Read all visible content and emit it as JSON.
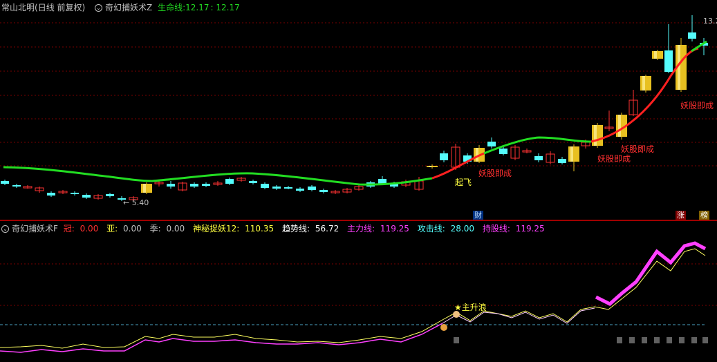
{
  "top": {
    "stock_name": "常山北明",
    "period": "(日线 前复权)",
    "indicator": "奇幻捕妖术Z",
    "line_label": "生命线:",
    "line_value1": "12.17",
    "line_value2": ": 12.17",
    "price_high": "13.2",
    "price_low": "5.40",
    "tags": [
      "起飞",
      "妖股即成",
      "妖股即成",
      "妖股即成",
      "妖股即成"
    ],
    "badges": [
      "财",
      "涨",
      "榜"
    ]
  },
  "bottom": {
    "indicator": "奇幻捕妖术F",
    "fields": [
      {
        "label": "冠:",
        "value": "0.00"
      },
      {
        "label": "亚:",
        "value": "0.00"
      },
      {
        "label": "季:",
        "value": "0.00"
      },
      {
        "label": "神秘捉妖12:",
        "value": "110.35"
      },
      {
        "label": "趋势线:",
        "value": "56.72"
      },
      {
        "label": "主力线:",
        "value": "119.25"
      },
      {
        "label": "攻击线:",
        "value": "28.00"
      },
      {
        "label": "持股线:",
        "value": "119.25"
      }
    ],
    "signal": "主升浪"
  },
  "colors": {
    "up": "#ff3232",
    "down": "#54fcfc",
    "gold": "#e8c020",
    "life_line_green": "#22dd22",
    "life_line_red": "#ff2020",
    "main_line": "#ff40ff",
    "trend_line": "#ffff60",
    "grid": "#7a0000"
  }
}
